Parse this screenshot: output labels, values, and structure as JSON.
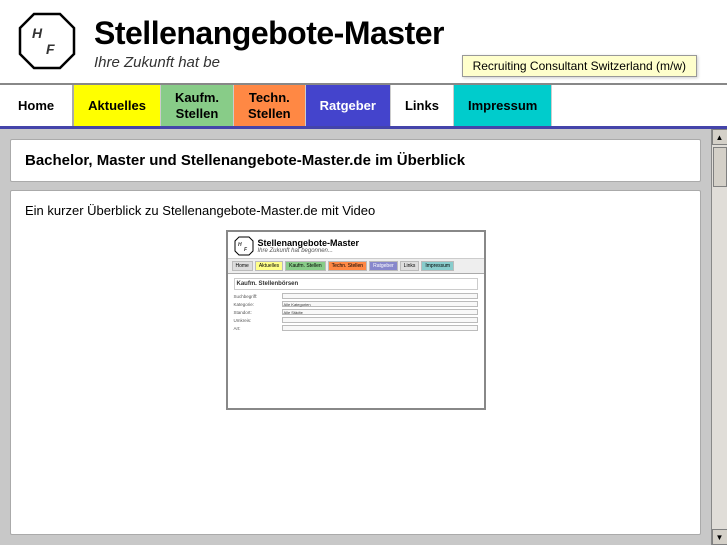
{
  "header": {
    "site_title": "Stellenangebote-Master",
    "subtitle": "Ihre Zukunft hat be",
    "subtitle_full": "Ihre Zukunft hat begonnen...",
    "tooltip": "Recruiting Consultant Switzerland (m/w)"
  },
  "logo": {
    "top_letter": "H",
    "bottom_letter": "F"
  },
  "navbar": {
    "items": [
      {
        "label": "Home",
        "class": "home"
      },
      {
        "label": "Aktuelles",
        "class": "aktuelles"
      },
      {
        "label": "Kaufm.\nStellen",
        "class": "kaufm"
      },
      {
        "label": "Techn.\nStellen",
        "class": "techn"
      },
      {
        "label": "Ratgeber",
        "class": "ratgeber"
      },
      {
        "label": "Links",
        "class": "links"
      },
      {
        "label": "Impressum",
        "class": "impressum"
      }
    ]
  },
  "main": {
    "title_box": {
      "heading": "Bachelor, Master und Stellenangebote-Master.de im Überblick"
    },
    "content_box": {
      "description": "Ein kurzer Überblick zu Stellenangebote-Master.de mit Video"
    }
  },
  "mini_browser": {
    "title": "Stellenangebote-Master",
    "subtitle": "Ihre Zukunft hat begonnen...",
    "section": "Kaufm. Stellenbörsen",
    "form_rows": [
      {
        "label": "Suchbegriff:",
        "value": ""
      },
      {
        "label": "Kategorie:",
        "value": "Alle Kategorien"
      },
      {
        "label": "Standort:",
        "value": "Alle Städte"
      },
      {
        "label": "Umkreis:",
        "value": ""
      },
      {
        "label": "Art:",
        "value": ""
      }
    ]
  },
  "scrollbar": {
    "up_arrow": "▲",
    "down_arrow": "▼"
  }
}
